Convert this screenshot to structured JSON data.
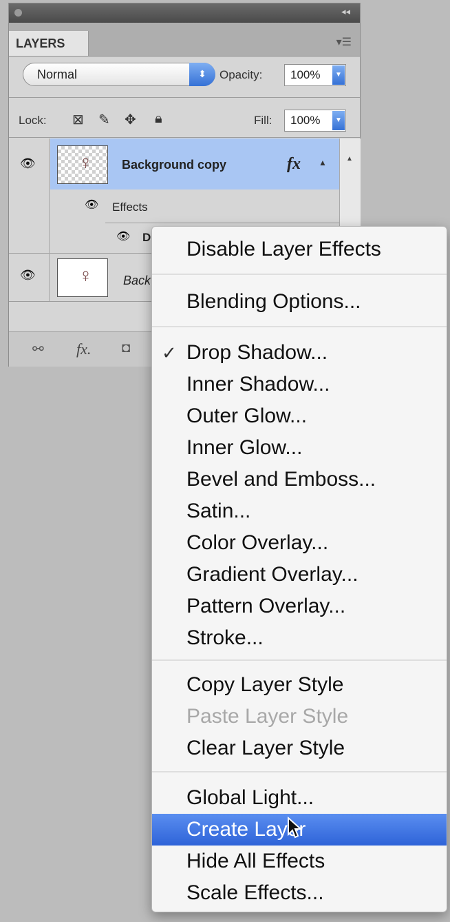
{
  "panel": {
    "tab_label": "LAYERS",
    "blend_mode": "Normal",
    "opacity_label": "Opacity:",
    "opacity_value": "100%",
    "lock_label": "Lock:",
    "fill_label": "Fill:",
    "fill_value": "100%",
    "layers": [
      {
        "name": "Background copy",
        "fx": "fx",
        "effects_label": "Effects",
        "effect_item": "D"
      },
      {
        "name": "Back"
      }
    ],
    "bottom_fx": "fx."
  },
  "context_menu": {
    "items": [
      {
        "label": "Disable Layer Effects"
      },
      {
        "label": "Blending Options..."
      },
      {
        "label": "Drop Shadow...",
        "checked": true
      },
      {
        "label": "Inner Shadow..."
      },
      {
        "label": "Outer Glow..."
      },
      {
        "label": "Inner Glow..."
      },
      {
        "label": "Bevel and Emboss..."
      },
      {
        "label": "Satin..."
      },
      {
        "label": "Color Overlay..."
      },
      {
        "label": "Gradient Overlay..."
      },
      {
        "label": "Pattern Overlay..."
      },
      {
        "label": "Stroke..."
      },
      {
        "label": "Copy Layer Style"
      },
      {
        "label": "Paste Layer Style",
        "disabled": true
      },
      {
        "label": "Clear Layer Style"
      },
      {
        "label": "Global Light..."
      },
      {
        "label": "Create Layer",
        "selected": true
      },
      {
        "label": "Hide All Effects"
      },
      {
        "label": "Scale Effects..."
      }
    ],
    "check_mark": "✓"
  },
  "colors": {
    "selection": "#2e63d8",
    "layer_selected_row": "#a9c6f3"
  }
}
